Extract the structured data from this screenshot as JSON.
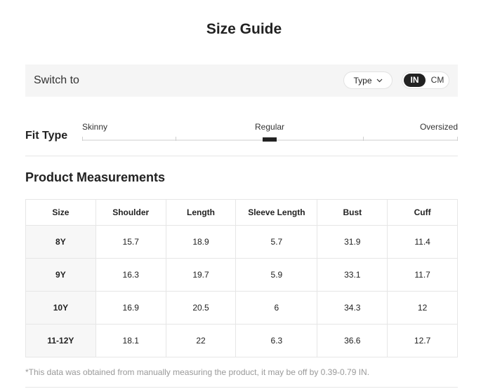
{
  "title": "Size Guide",
  "switch": {
    "label": "Switch to",
    "type_label": "Type",
    "units": [
      "IN",
      "CM"
    ],
    "active_unit": "IN"
  },
  "fit": {
    "label": "Fit Type",
    "options": [
      "Skinny",
      "Regular",
      "Oversized"
    ],
    "selected": "Regular"
  },
  "measurements": {
    "title": "Product Measurements",
    "headers": [
      "Size",
      "Shoulder",
      "Length",
      "Sleeve Length",
      "Bust",
      "Cuff"
    ],
    "rows": [
      [
        "8Y",
        "15.7",
        "18.9",
        "5.7",
        "31.9",
        "11.4"
      ],
      [
        "9Y",
        "16.3",
        "19.7",
        "5.9",
        "33.1",
        "11.7"
      ],
      [
        "10Y",
        "16.9",
        "20.5",
        "6",
        "34.3",
        "12"
      ],
      [
        "11-12Y",
        "18.1",
        "22",
        "6.3",
        "36.6",
        "12.7"
      ]
    ]
  },
  "note": "*This data was obtained from manually measuring the product, it may be off by 0.39-0.79 IN."
}
